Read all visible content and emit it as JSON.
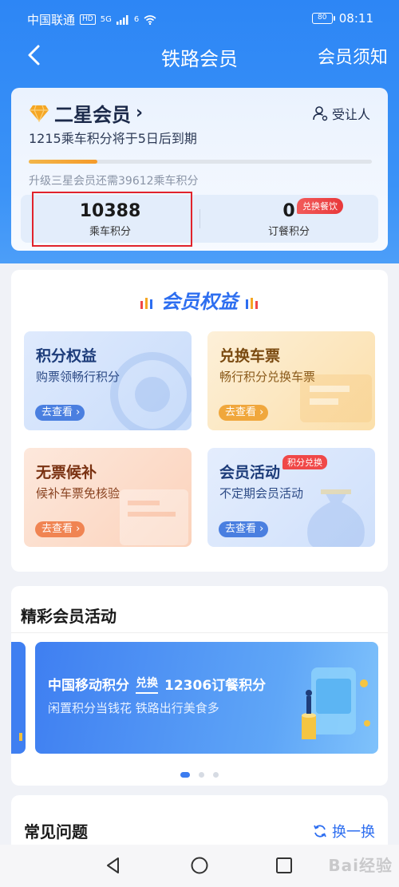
{
  "status_bar": {
    "carrier": "中国联通",
    "hd": "HD",
    "signal_label": "5G",
    "wifi_label": "6",
    "battery": "80",
    "time": "08:11"
  },
  "nav": {
    "title": "铁路会员",
    "right_link": "会员须知"
  },
  "member": {
    "level": "二星会员",
    "expiry_notice": "1215乘车积分将于5日后到期",
    "transfer_label": "受让人",
    "upgrade_notice": "升级三星会员还需39612乘车积分",
    "progress_fraction": 0.2,
    "ride_points": "10388",
    "ride_points_label": "乘车积分",
    "meal_points": "0",
    "meal_points_label": "订餐积分",
    "meal_badge": "兑换餐饮"
  },
  "benefits": {
    "title": "会员权益",
    "tiles": [
      {
        "title": "积分权益",
        "subtitle": "购票领畅行积分",
        "button": "去查看"
      },
      {
        "title": "兑换车票",
        "subtitle": "畅行积分兑换车票",
        "button": "去查看"
      },
      {
        "title": "无票候补",
        "subtitle": "候补车票免核验",
        "button": "去查看"
      },
      {
        "title": "会员活动",
        "subtitle": "不定期会员活动",
        "button": "去查看",
        "badge": "积分兑换"
      }
    ]
  },
  "activities": {
    "title": "精彩会员活动",
    "banner": {
      "source": "中国移动积分",
      "exchange": "兑换",
      "target": "12306订餐积分",
      "tagline": "闲置积分当钱花 铁路出行美食多"
    }
  },
  "faq": {
    "title": "常见问题",
    "refresh": "换一换"
  },
  "colors": {
    "primary": "#2d86f5",
    "accent_blue": "#2d6ef0",
    "highlight_red": "#e1232b",
    "badge_red": "#f04848"
  }
}
